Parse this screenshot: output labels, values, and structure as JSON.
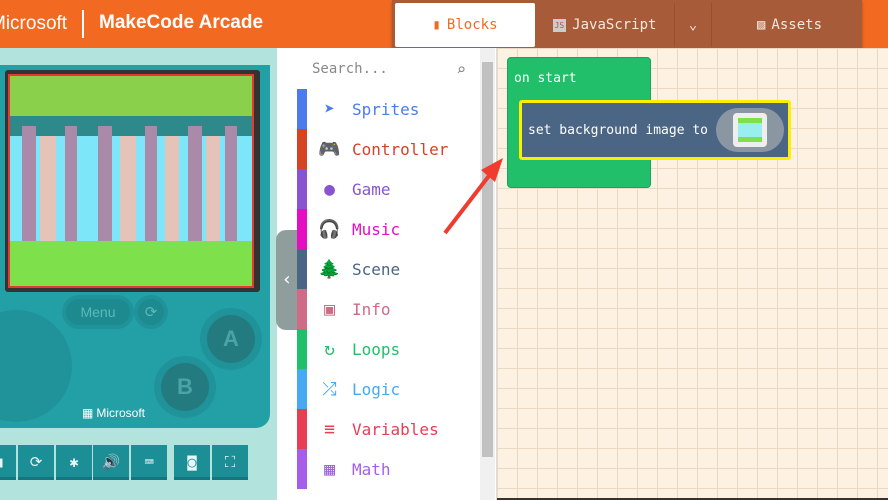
{
  "header": {
    "brand": "Microsoft",
    "app": "MakeCode Arcade",
    "tabs": [
      {
        "label": "Blocks",
        "icon": "puzzle-icon"
      },
      {
        "label": "JavaScript",
        "icon": "js-icon"
      },
      {
        "label": "Assets",
        "icon": "image-icon"
      }
    ]
  },
  "simulator": {
    "menu_label": "Menu",
    "a_label": "A",
    "b_label": "B",
    "brand": "Microsoft"
  },
  "toolbox": {
    "search_placeholder": "Search...",
    "categories": [
      {
        "label": "Sprites",
        "color": "#4b7bec",
        "icon": "➤"
      },
      {
        "label": "Controller",
        "color": "#d54322",
        "icon": "🎮"
      },
      {
        "label": "Game",
        "color": "#8854d0",
        "icon": "●"
      },
      {
        "label": "Music",
        "color": "#e30fc0",
        "icon": "🎧"
      },
      {
        "label": "Scene",
        "color": "#4b6584",
        "icon": "🌲"
      },
      {
        "label": "Info",
        "color": "#cf6a87",
        "icon": "▣"
      },
      {
        "label": "Loops",
        "color": "#20bf6b",
        "icon": "↻"
      },
      {
        "label": "Logic",
        "color": "#45aaf2",
        "icon": "⤮"
      },
      {
        "label": "Variables",
        "color": "#e73d55",
        "icon": "≡"
      },
      {
        "label": "Math",
        "color": "#a55eea",
        "icon": "▦"
      }
    ]
  },
  "workspace": {
    "event_block": "on start",
    "statement_block": "set background image to"
  }
}
